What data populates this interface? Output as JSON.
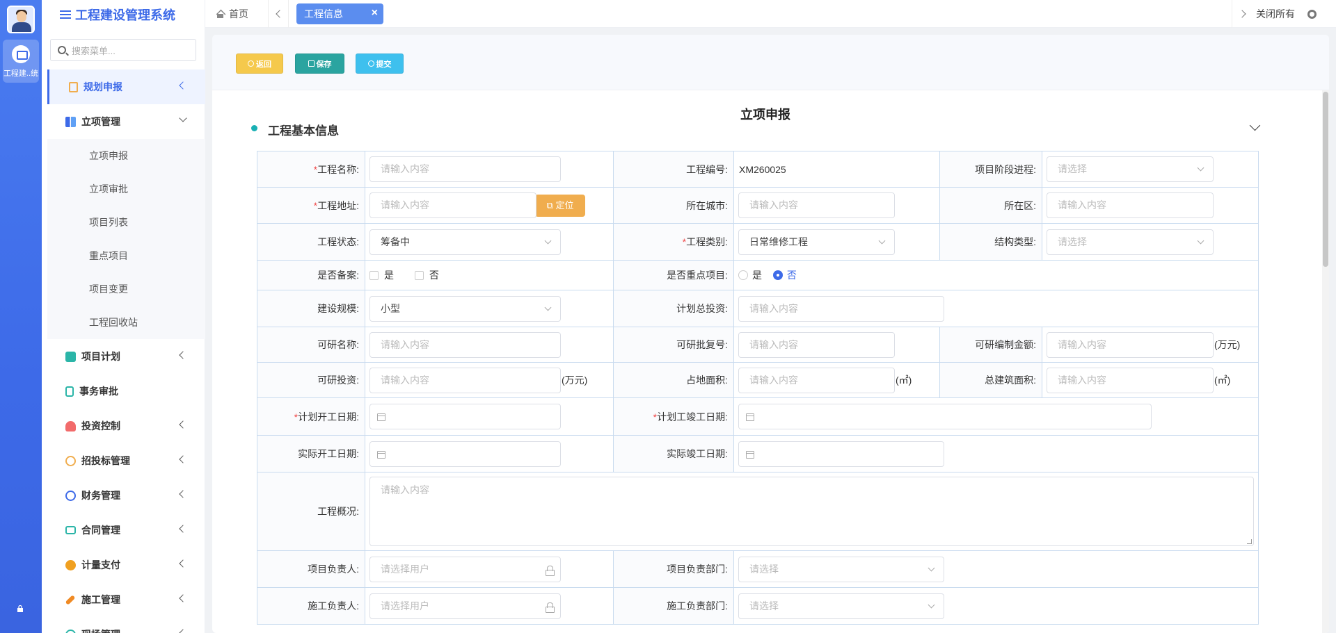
{
  "app": {
    "title": "工程建设管理系统",
    "rail_app_label": "工程建..统"
  },
  "search": {
    "placeholder": "搜索菜单..."
  },
  "menu": {
    "plan_report": "规划申报",
    "project_mgmt": "立项管理",
    "sub": [
      "立项申报",
      "立项审批",
      "项目列表",
      "重点项目",
      "项目变更",
      "工程回收站"
    ],
    "items": [
      "项目计划",
      "事务审批",
      "投资控制",
      "招投标管理",
      "财务管理",
      "合同管理",
      "计量支付",
      "施工管理",
      "现场管理"
    ]
  },
  "tabs": {
    "home": "首页",
    "active": "工程信息",
    "close_all": "关闭所有"
  },
  "toolbar": {
    "back": "返回",
    "save": "保存",
    "submit": "提交"
  },
  "page": {
    "heading": "立项申报",
    "section": "工程基本信息"
  },
  "form": {
    "name_label": "工程名称:",
    "placeholder_input": "请输入内容",
    "placeholder_select": "请选择",
    "placeholder_user": "请选择用户",
    "code_label": "工程编号:",
    "code_value": "XM260025",
    "stage_label": "项目阶段进程:",
    "address_label": "工程地址:",
    "locate_btn": "定位",
    "city_label": "所在城市:",
    "district_label": "所在区:",
    "status_label": "工程状态:",
    "status_value": "筹备中",
    "category_label": "工程类别:",
    "category_value": "日常维修工程",
    "structure_label": "结构类型:",
    "filed_label": "是否备案:",
    "key_label": "是否重点项目:",
    "yes": "是",
    "no": "否",
    "scale_label": "建设规模:",
    "scale_value": "小型",
    "total_invest_label": "计划总投资:",
    "fs_name_label": "可研名称:",
    "fs_reply_label": "可研批复号:",
    "fs_amount_label": "可研编制金额:",
    "unit_wan": "(万元)",
    "fs_invest_label": "可研投资:",
    "land_label": "占地面积:",
    "building_label": "总建筑面积:",
    "unit_sqm": "(㎡)",
    "plan_start_label": "计划开工日期:",
    "plan_end_label": "计划工竣工日期:",
    "actual_start_label": "实际开工日期:",
    "actual_end_label": "实际竣工日期:",
    "overview_label": "工程概况:",
    "pm_label": "项目负责人:",
    "pm_dept_label": "项目负责部门:",
    "cm_label": "施工负责人:",
    "cm_dept_label": "施工负责部门:"
  },
  "colors": {
    "primary": "#3d6ae8",
    "warning": "#f0ad4e",
    "teal": "#2aa4a0",
    "sky": "#3ec0ee",
    "required": "#f04848"
  }
}
